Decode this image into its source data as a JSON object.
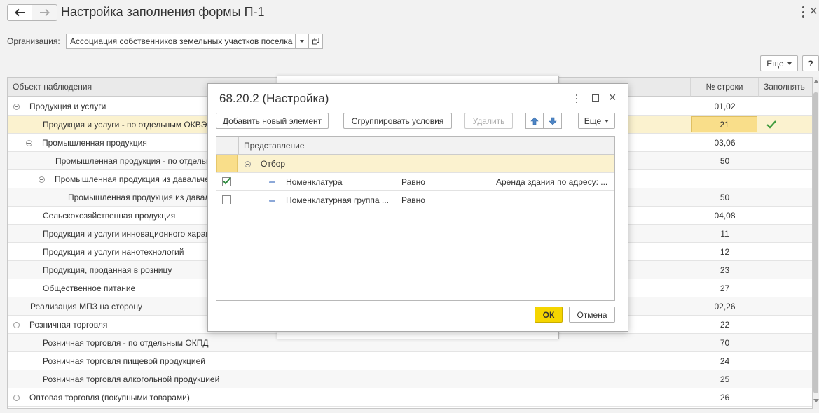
{
  "header": {
    "title": "Настройка заполнения формы П-1",
    "back_icon": "arrow-left-icon",
    "forward_icon": "arrow-right-icon"
  },
  "org": {
    "label": "Организация:",
    "value": "Ассоциация собственников земельных участков поселка I"
  },
  "toolbar": {
    "more_label": "Еще",
    "help_label": "?"
  },
  "table": {
    "columns": [
      "Объект наблюдения",
      "№ строки",
      "Заполнять"
    ],
    "rows": [
      {
        "name": "Продукция и услуги",
        "num": "01,02",
        "check": false
      },
      {
        "name": "Продукция и услуги - по отдельным ОКВЭД",
        "num": "21",
        "check": true
      },
      {
        "name": "Промышленная продукция",
        "num": "03,06",
        "check": false
      },
      {
        "name": "Промышленная продукция - по отдельным",
        "num": "50",
        "check": false
      },
      {
        "name": "Промышленная продукция из давальческого",
        "num": "",
        "check": false
      },
      {
        "name": "Промышленная продукция из давальческого",
        "num": "50",
        "check": false
      },
      {
        "name": "Сельскохозяйственная продукция",
        "num": "04,08",
        "check": false
      },
      {
        "name": "Продукция и услуги инновационного характера",
        "num": "11",
        "check": false
      },
      {
        "name": "Продукция и услуги нанотехнологий",
        "num": "12",
        "check": false
      },
      {
        "name": "Продукция, проданная в розницу",
        "num": "23",
        "check": false
      },
      {
        "name": "Общественное питание",
        "num": "27",
        "check": false
      },
      {
        "name": "Реализация МПЗ на сторону",
        "num": "02,26",
        "check": false
      },
      {
        "name": "Розничная торговля",
        "num": "22",
        "check": false
      },
      {
        "name": "Розничная торговля - по отдельным ОКПД",
        "num": "70",
        "check": false
      },
      {
        "name": "Розничная торговля пищевой продукцией",
        "num": "24",
        "check": false
      },
      {
        "name": "Розничная торговля алкогольной продукцией",
        "num": "25",
        "check": false
      },
      {
        "name": "Оптовая торговля (покупными товарами)",
        "num": "26",
        "check": false
      }
    ]
  },
  "dialog": {
    "title": "68.20.2 (Настройка)",
    "add_label": "Добавить новый элемент",
    "group_label": "Сгруппировать условия",
    "delete_label": "Удалить",
    "more_label": "Еще",
    "column": "Представление",
    "group_row": "Отбор",
    "items": [
      {
        "name": "Номенклатура",
        "cond": "Равно",
        "value": "Аренда здания по адресу: ...",
        "checked": true
      },
      {
        "name": "Номенклатурная группа ...",
        "cond": "Равно",
        "value": "",
        "checked": false
      }
    ],
    "ok_label": "ОК",
    "cancel_label": "Отмена"
  },
  "colors": {
    "selected_row": "#fbf2cf",
    "active_cell": "#f9de8a",
    "ok_button": "#f5d500",
    "check_green": "#3c9a3c"
  }
}
